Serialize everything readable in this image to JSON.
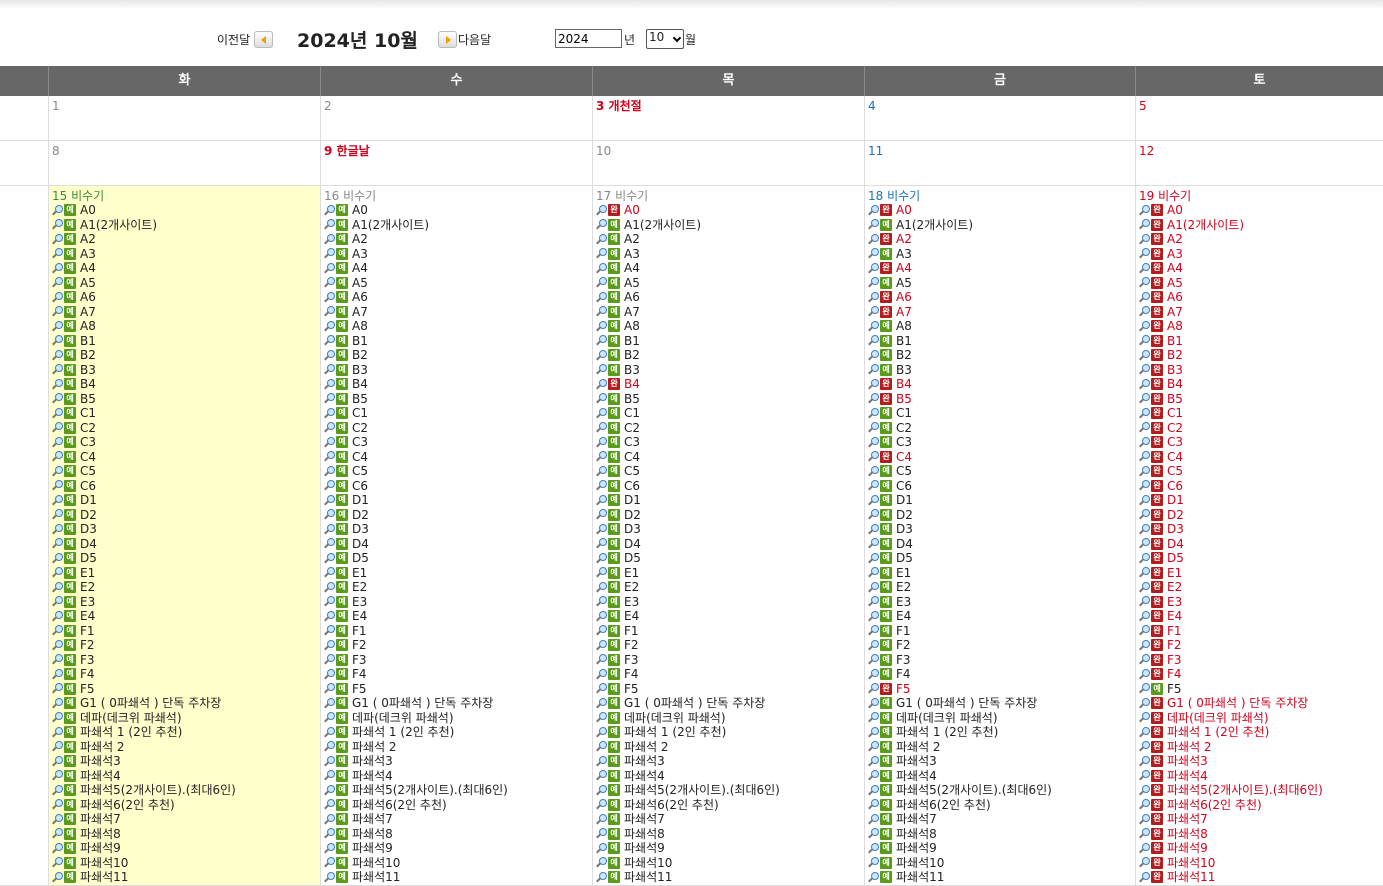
{
  "nav": {
    "prev_label": "이전달",
    "title": "2024년 10월",
    "next_label": "다음달",
    "year_value": "2024",
    "year_unit": "년",
    "month_value": "10",
    "month_unit": "월"
  },
  "weekdays": [
    "화",
    "수",
    "목",
    "금",
    "토"
  ],
  "week1": [
    {
      "num": "1",
      "type": "normal"
    },
    {
      "num": "2",
      "type": "normal"
    },
    {
      "num": "3 개천절",
      "type": "holiday"
    },
    {
      "num": "4",
      "type": "fri"
    },
    {
      "num": "5",
      "type": "sat"
    }
  ],
  "week2": [
    {
      "num": "8",
      "type": "normal"
    },
    {
      "num": "9 한글날",
      "type": "holiday"
    },
    {
      "num": "10",
      "type": "normal"
    },
    {
      "num": "11",
      "type": "fri"
    },
    {
      "num": "12",
      "type": "sat"
    }
  ],
  "week3_heads": [
    {
      "num": "15 비수기",
      "type": "green"
    },
    {
      "num": "16 비수기",
      "type": "normal"
    },
    {
      "num": "17 비수기",
      "type": "normal"
    },
    {
      "num": "18 비수기",
      "type": "fri"
    },
    {
      "num": "19 비수기",
      "type": "sat"
    }
  ],
  "badge_labels": {
    "reserve": "예",
    "complete": "완"
  },
  "sites": [
    "A0",
    "A1(2개사이트)",
    "A2",
    "A3",
    "A4",
    "A5",
    "A6",
    "A7",
    "A8",
    "B1",
    "B2",
    "B3",
    "B4",
    "B5",
    "C1",
    "C2",
    "C3",
    "C4",
    "C5",
    "C6",
    "D1",
    "D2",
    "D3",
    "D4",
    "D5",
    "E1",
    "E2",
    "E3",
    "E4",
    "F1",
    "F2",
    "F3",
    "F4",
    "F5",
    "G1 ( 0파쇄석 ) 단독 주차장",
    "데파(데크위 파쇄석)",
    "파쇄석 1 (2인 추천)",
    "파쇄석 2",
    "파쇄석3",
    "파쇄석4",
    "파쇄석5(2개사이트).(최대6인)",
    "파쇄석6(2인 추천)",
    "파쇄석7",
    "파쇄석8",
    "파쇄석9",
    "파쇄석10",
    "파쇄석11"
  ],
  "status": {
    "d15": "",
    "d16": "",
    "d17": "100000000000100000000000000000000000000000000000",
    "d18": "101010110000110001000000000000000100000000000000",
    "d19": "111111111111111111111111111111111011111111111111"
  }
}
